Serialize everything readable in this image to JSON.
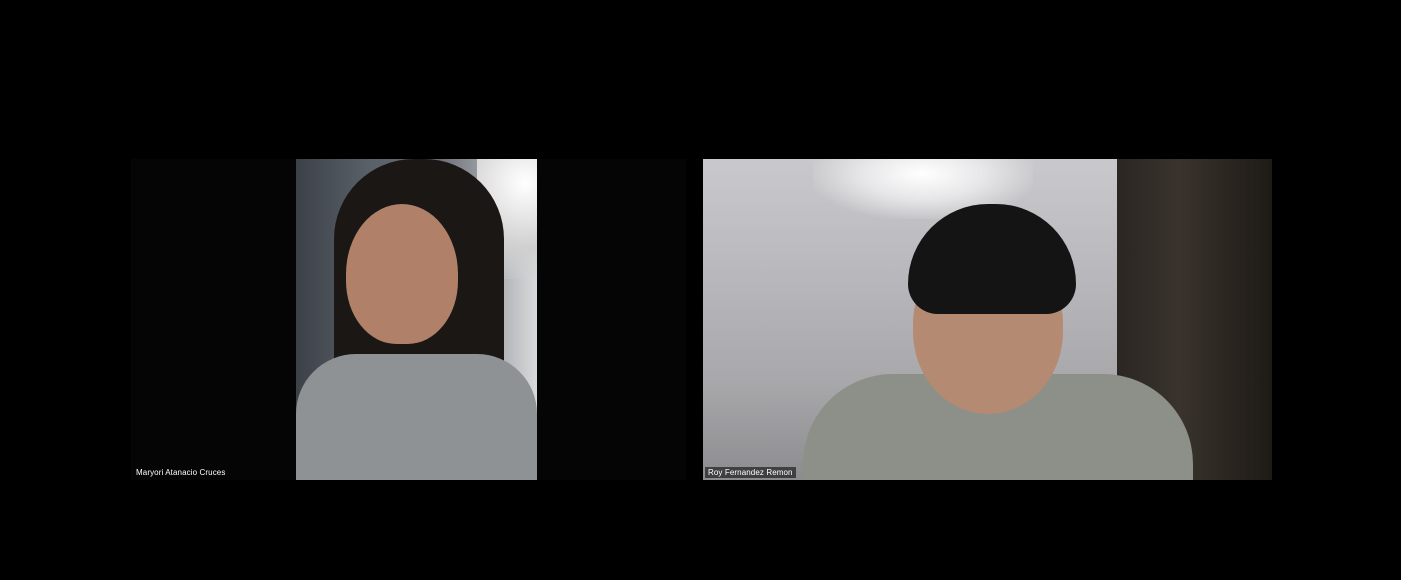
{
  "meeting": {
    "participants": [
      {
        "name": "Maryori Atanacio Cruces",
        "camera_on": true
      },
      {
        "name": "Roy Fernandez Remon",
        "camera_on": true
      }
    ]
  },
  "colors": {
    "background": "#000000",
    "name_label_text": "#ffffff"
  }
}
